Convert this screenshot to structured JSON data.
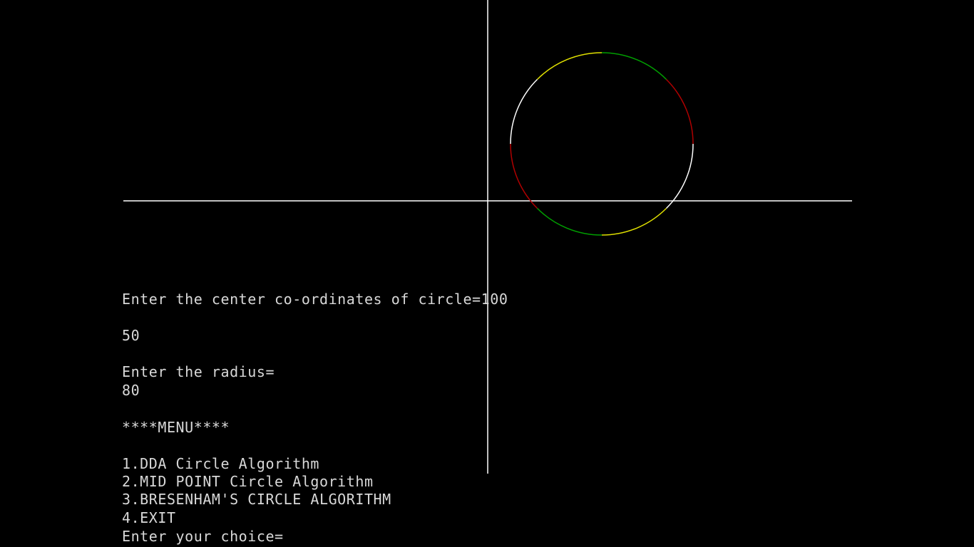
{
  "colors": {
    "background": "#000000",
    "axis": "#ffffff",
    "text": "#d8d8d8",
    "circle_octants": [
      "#ffffff",
      "#b00000",
      "#00a000",
      "#e0e000"
    ]
  },
  "console": {
    "center_prompt": "Enter the center co-ordinates of circle=100",
    "center_y_value": "50",
    "radius_prompt": "Enter the radius=",
    "radius_value": "80",
    "menu_title": "****MENU****",
    "menu_items": [
      "1.DDA Circle Algorithm",
      "2.MID POINT Circle Algorithm",
      "3.BRESENHAM'S CIRCLE ALGORITHM",
      "4.EXIT"
    ],
    "choice_prompt": "Enter your choice="
  }
}
